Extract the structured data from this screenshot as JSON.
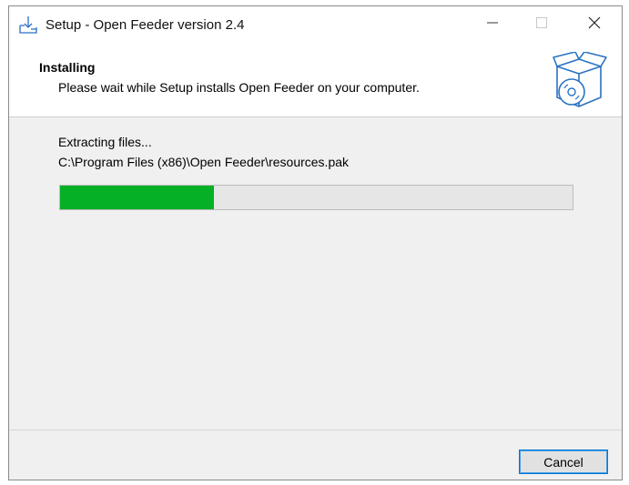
{
  "window": {
    "title": "Setup - Open Feeder version 2.4",
    "icons": {
      "app": "install-download-icon",
      "minimize": "minimize-icon",
      "maximize": "maximize-icon",
      "close": "close-icon"
    }
  },
  "header": {
    "title": "Installing",
    "subtitle": "Please wait while Setup installs Open Feeder on your computer.",
    "icon": "software-box-disc-icon"
  },
  "body": {
    "status": "Extracting files...",
    "file_path": "C:\\Program Files (x86)\\Open Feeder\\resources.pak",
    "progress_fraction": 0.3,
    "progress_color": "#06b025"
  },
  "footer": {
    "cancel_label": "Cancel"
  }
}
